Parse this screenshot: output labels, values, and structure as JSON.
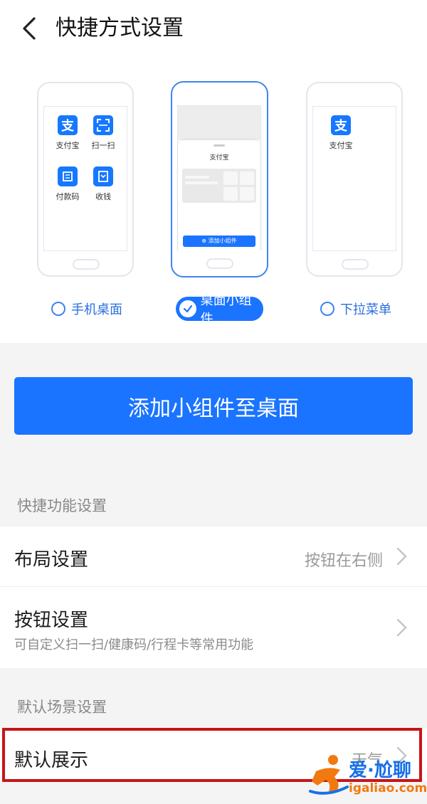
{
  "header": {
    "title": "快捷方式设置",
    "back_icon": "chevron-left-icon"
  },
  "mode_picker": {
    "options": [
      {
        "label": "手机桌面",
        "selected": false,
        "apps": [
          {
            "label": "支付宝",
            "icon": "alipay-icon"
          },
          {
            "label": "扫一扫",
            "icon": "scan-icon"
          },
          {
            "label": "付款码",
            "icon": "payment-code-icon"
          },
          {
            "label": "收钱",
            "icon": "collect-money-icon"
          }
        ]
      },
      {
        "label": "桌面小组件",
        "selected": true,
        "widget_title": "支付宝",
        "widget_button": "添加小组件"
      },
      {
        "label": "下拉菜单",
        "selected": false,
        "apps": [
          {
            "label": "支付宝",
            "icon": "alipay-icon"
          }
        ]
      }
    ]
  },
  "add_widget_button": "添加小组件至桌面",
  "sections": {
    "shortcut_title": "快捷功能设置",
    "scene_title": "默认场景设置"
  },
  "rows": {
    "layout": {
      "title": "布局设置",
      "value": "按钮在右侧"
    },
    "buttons": {
      "title": "按钮设置",
      "subtitle": "可自定义扫一扫/健康码/行程卡等常用功能"
    },
    "default_display": {
      "title": "默认展示",
      "value": "天气"
    }
  },
  "watermark": {
    "name": "爱·尬聊",
    "url": "igaliao.com"
  },
  "colors": {
    "accent": "#1a74ff",
    "highlight_border": "#c81418"
  }
}
